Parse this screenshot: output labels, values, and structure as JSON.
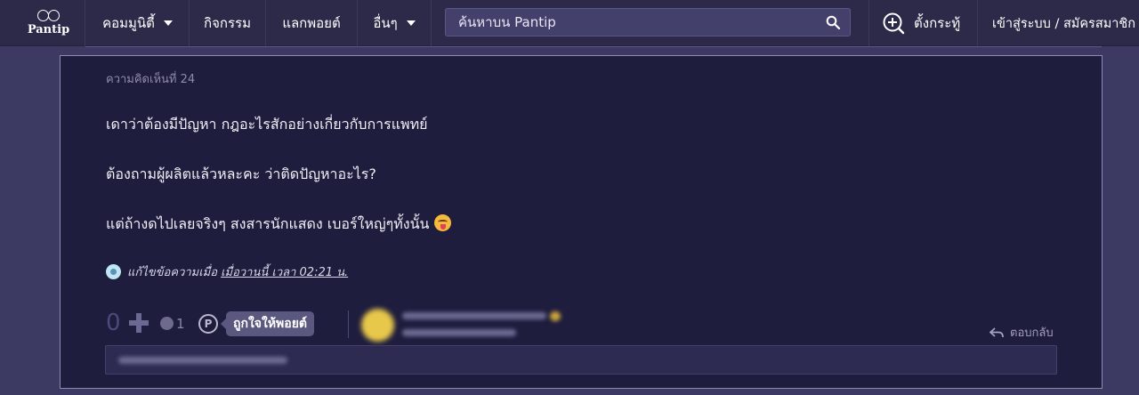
{
  "nav": {
    "logo_text": "Pantip",
    "items": [
      {
        "label": "คอมมูนิตี้",
        "has_caret": true
      },
      {
        "label": "กิจกรรม",
        "has_caret": false
      },
      {
        "label": "แลกพอยต์",
        "has_caret": false
      },
      {
        "label": "อื่นๆ",
        "has_caret": true
      }
    ],
    "search_placeholder": "ค้นหาบน Pantip",
    "create_label": "ตั้งกระทู้",
    "login_label": "เข้าสู่ระบบ / สมัครสมาชิก"
  },
  "comment": {
    "number_label": "ความคิดเห็นที่ 24",
    "lines": [
      "เดาว่าต้องมีปัญหา กฎอะไรสักอย่างเกี่ยวกับการแพทย์",
      "ต้องถามผู้ผลิตแล้วหละคะ ว่าติดปัญหาอะไร?",
      "แต่ถ้างดไปเลยจริงๆ สงสารนักแสดง เบอร์ใหญ่ๆทั้งนั้น"
    ],
    "edit_prefix": "แก้ไขข้อความเมื่อ",
    "edit_time": "เมื่อวานนี้ เวลา 02:21 น.",
    "vote_count": "0",
    "emotion_count": "1",
    "point_icon_letter": "P",
    "tooltip": "ถูกใจให้พอยต์",
    "reply_label": "ตอบกลับ"
  },
  "colors": {
    "page_bg": "#3c3963",
    "nav_bg": "#2c2a48",
    "card_bg": "#1f1d3e",
    "accent": "#5b5880"
  }
}
